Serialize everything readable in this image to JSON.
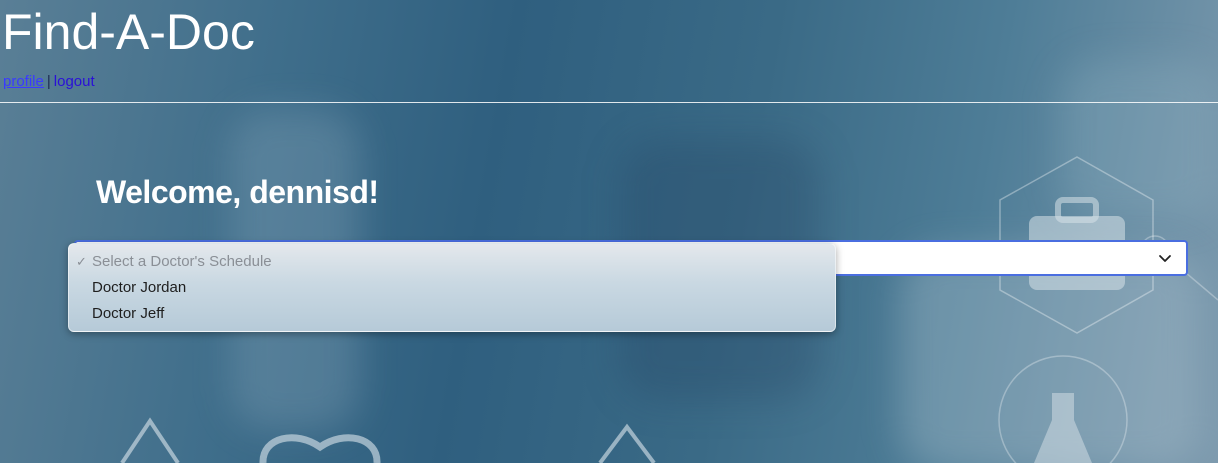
{
  "header": {
    "title": "Find-A-Doc",
    "nav": {
      "profile_label": "profile",
      "separator": "|",
      "logout_label": "logout"
    }
  },
  "main": {
    "welcome": "Welcome, dennisd!",
    "doctor_select": {
      "options": [
        {
          "label": "Select a Doctor's Schedule",
          "selected": true,
          "disabled": true
        },
        {
          "label": "Doctor Jordan",
          "selected": false,
          "disabled": false
        },
        {
          "label": "Doctor Jeff",
          "selected": false,
          "disabled": false
        }
      ]
    }
  },
  "colors": {
    "accent_border": "#4a6ee0",
    "link": "#3a3aff",
    "logout_link": "#2a10d8",
    "background": "#3a6a86"
  },
  "icons": {
    "select_chevron": "chevron-down-icon",
    "selected_check": "check-icon",
    "background_medical_icons": [
      "medical-bag-icon",
      "flask-icon",
      "heart-icon",
      "pulse-icon"
    ]
  }
}
